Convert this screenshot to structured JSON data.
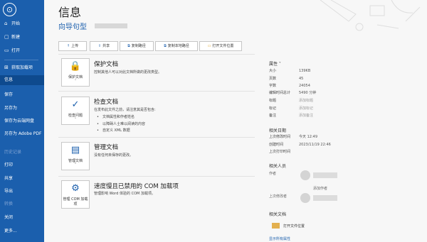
{
  "sidebar": {
    "back_symbol": "⊙",
    "items": [
      {
        "label": "开始",
        "icon": "⌂"
      },
      {
        "label": "新建",
        "icon": "▢"
      },
      {
        "label": "打开",
        "icon": "▭"
      },
      {
        "label": "获取加载项",
        "icon": "⊞"
      },
      {
        "label": "信息"
      },
      {
        "label": "保存"
      },
      {
        "label": "另存为"
      },
      {
        "label": "保存为云端网盘"
      },
      {
        "label": "另存为 Adobe PDF"
      },
      {
        "label": "历史记录"
      },
      {
        "label": "打印"
      },
      {
        "label": "共享"
      },
      {
        "label": "导出"
      },
      {
        "label": "转换"
      },
      {
        "label": "关闭"
      },
      {
        "label": "更多..."
      }
    ]
  },
  "main": {
    "title": "信息",
    "doc_name": "向导句型",
    "toolbar": [
      {
        "label": "上传",
        "icon": "↑"
      },
      {
        "label": "共享",
        "icon": "⇧"
      },
      {
        "label": "复制路径",
        "icon": "⧉"
      },
      {
        "label": "复制本地路径",
        "icon": "⧉"
      },
      {
        "label": "打开文件位置",
        "icon": "▭"
      }
    ],
    "sections": [
      {
        "icon_label": "保护文档",
        "title": "保护文档",
        "desc": "控制其他人可以对此文档所做的更改类型。"
      },
      {
        "icon_label": "检查问题",
        "title": "检查文档",
        "desc": "在发布此文件之前，请注意其是否包含:",
        "bullets": [
          "文档属性和作者姓名",
          "以障碍人士难以阅读的内容",
          "自定义 XML 数据"
        ]
      },
      {
        "icon_label": "管理文档",
        "title": "管理文档",
        "desc": "没有任何未保存的更改。"
      },
      {
        "icon_label": "管理 COM 加载项",
        "title": "速度慢且已禁用的 COM 加载项",
        "desc": "管理影响 Word 体验的 COM 加载项。"
      }
    ]
  },
  "properties": {
    "header": "属性 ˅",
    "rows": [
      {
        "key": "大小",
        "value": "139KB"
      },
      {
        "key": "页数",
        "value": "45"
      },
      {
        "key": "字数",
        "value": "24054"
      },
      {
        "key": "编辑时间总计",
        "value": "5490 分钟"
      },
      {
        "key": "标题",
        "value": "添加标题"
      },
      {
        "key": "标记",
        "value": "添加标记"
      },
      {
        "key": "备注",
        "value": "添加备注"
      }
    ],
    "dates_header": "相关日期",
    "dates": [
      {
        "key": "上次修改时间",
        "value": "今天 12:49"
      },
      {
        "key": "创建时间",
        "value": "2023/11/19 22:46"
      },
      {
        "key": "上次打印时间",
        "value": ""
      }
    ],
    "people_header": "相关人员",
    "author_label": "作者",
    "add_author": "添加作者",
    "modified_by_label": "上次修改者",
    "docs_header": "相关文档",
    "open_location": "打开文件位置",
    "show_all": "显示所有属性"
  },
  "colors": {
    "sidebar": "#1b5fad",
    "accent": "#1b5fad"
  }
}
